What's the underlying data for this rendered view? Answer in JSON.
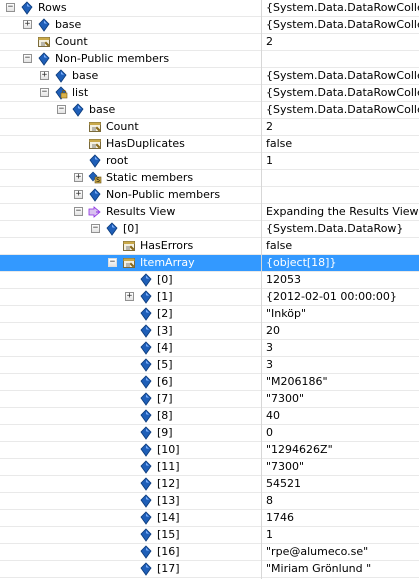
{
  "colors": {
    "selection": "#3399ff",
    "field_icon": "#1f5fb8",
    "property_icon": "#a8801c",
    "results_icon": "#8a2be2"
  },
  "rows": [
    {
      "name": "Rows",
      "value": "{System.Data.DataRowCollec",
      "indent": 0,
      "expander": "minus",
      "icon": "field-icon"
    },
    {
      "name": "base",
      "value": "{System.Data.DataRowCollec",
      "indent": 1,
      "expander": "plus",
      "icon": "field-icon"
    },
    {
      "name": "Count",
      "value": "2",
      "indent": 1,
      "expander": "",
      "icon": "property-icon"
    },
    {
      "name": "Non-Public members",
      "value": "",
      "indent": 1,
      "expander": "minus",
      "icon": "field-icon"
    },
    {
      "name": "base",
      "value": "{System.Data.DataRowCollec",
      "indent": 2,
      "expander": "plus",
      "icon": "field-icon"
    },
    {
      "name": "list",
      "value": "{System.Data.DataRowCollec",
      "indent": 2,
      "expander": "minus",
      "icon": "private-field-icon"
    },
    {
      "name": "base",
      "value": "{System.Data.DataRowCollec",
      "indent": 3,
      "expander": "minus",
      "icon": "field-icon"
    },
    {
      "name": "Count",
      "value": "2",
      "indent": 4,
      "expander": "",
      "icon": "property-icon"
    },
    {
      "name": "HasDuplicates",
      "value": "false",
      "indent": 4,
      "expander": "",
      "icon": "property-icon"
    },
    {
      "name": "root",
      "value": "1",
      "indent": 4,
      "expander": "",
      "icon": "field-icon"
    },
    {
      "name": "Static members",
      "value": "",
      "indent": 4,
      "expander": "plus",
      "icon": "static-members-icon"
    },
    {
      "name": "Non-Public members",
      "value": "",
      "indent": 4,
      "expander": "plus",
      "icon": "field-icon"
    },
    {
      "name": "Results View",
      "value": "Expanding the Results View w",
      "indent": 4,
      "expander": "minus",
      "icon": "results-view-icon"
    },
    {
      "name": "[0]",
      "value": "{System.Data.DataRow}",
      "indent": 5,
      "expander": "minus",
      "icon": "field-icon"
    },
    {
      "name": "HasErrors",
      "value": "false",
      "indent": 6,
      "expander": "",
      "icon": "property-icon"
    },
    {
      "name": "ItemArray",
      "value": "{object[18]}",
      "indent": 6,
      "expander": "minus",
      "icon": "property-icon",
      "selected": true
    },
    {
      "name": "[0]",
      "value": "12053",
      "indent": 7,
      "expander": "",
      "icon": "field-icon"
    },
    {
      "name": "[1]",
      "value": "{2012-02-01 00:00:00}",
      "indent": 7,
      "expander": "plus",
      "icon": "field-icon"
    },
    {
      "name": "[2]",
      "value": "\"Inköp\"",
      "indent": 7,
      "expander": "",
      "icon": "field-icon"
    },
    {
      "name": "[3]",
      "value": "20",
      "indent": 7,
      "expander": "",
      "icon": "field-icon"
    },
    {
      "name": "[4]",
      "value": "3",
      "indent": 7,
      "expander": "",
      "icon": "field-icon"
    },
    {
      "name": "[5]",
      "value": "3",
      "indent": 7,
      "expander": "",
      "icon": "field-icon"
    },
    {
      "name": "[6]",
      "value": "\"M206186\"",
      "indent": 7,
      "expander": "",
      "icon": "field-icon"
    },
    {
      "name": "[7]",
      "value": "\"7300\"",
      "indent": 7,
      "expander": "",
      "icon": "field-icon"
    },
    {
      "name": "[8]",
      "value": "40",
      "indent": 7,
      "expander": "",
      "icon": "field-icon"
    },
    {
      "name": "[9]",
      "value": "0",
      "indent": 7,
      "expander": "",
      "icon": "field-icon"
    },
    {
      "name": "[10]",
      "value": "\"1294626Z\"",
      "indent": 7,
      "expander": "",
      "icon": "field-icon"
    },
    {
      "name": "[11]",
      "value": "\"7300\"",
      "indent": 7,
      "expander": "",
      "icon": "field-icon"
    },
    {
      "name": "[12]",
      "value": "54521",
      "indent": 7,
      "expander": "",
      "icon": "field-icon"
    },
    {
      "name": "[13]",
      "value": "8",
      "indent": 7,
      "expander": "",
      "icon": "field-icon"
    },
    {
      "name": "[14]",
      "value": "1746",
      "indent": 7,
      "expander": "",
      "icon": "field-icon"
    },
    {
      "name": "[15]",
      "value": "1",
      "indent": 7,
      "expander": "",
      "icon": "field-icon"
    },
    {
      "name": "[16]",
      "value": "\"rpe@alumeco.se\"",
      "indent": 7,
      "expander": "",
      "icon": "field-icon"
    },
    {
      "name": "[17]",
      "value": "\"Miriam Grönlund \"",
      "indent": 7,
      "expander": "",
      "icon": "field-icon"
    }
  ]
}
